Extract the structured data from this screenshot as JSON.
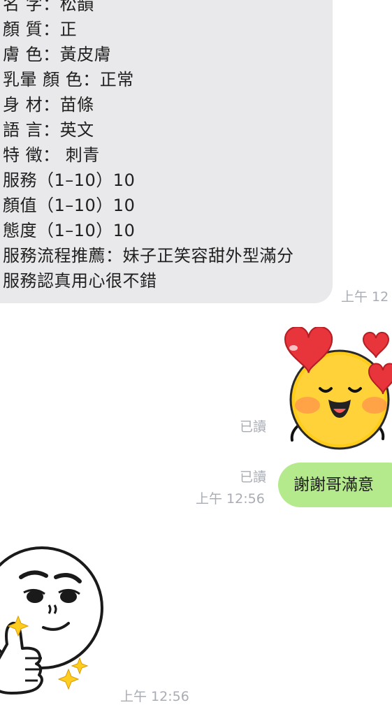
{
  "messages": {
    "incoming_text": {
      "lines": [
        "名 字：松韻",
        "顏 質：正",
        "膚 色：黃皮膚",
        "乳暈 顏 色：正常",
        "身 材：苗條",
        "語 言：英文",
        "特 徵： 刺青",
        "服務（1–10）10",
        "顏值（1–10）10",
        "態度（1–10）10",
        "服務流程推薦：妹子正笑容甜外型滿分",
        "服務認真用心很不錯"
      ],
      "time": "上午 12"
    },
    "outgoing_sticker": {
      "icon": "heart-eyes-face-sticker",
      "read_label": "已讀"
    },
    "outgoing_text": {
      "text": "謝謝哥滿意",
      "read_label": "已讀",
      "time": "上午 12:56"
    },
    "incoming_sticker": {
      "icon": "thumbs-up-smug-face-sticker",
      "time": "上午 12:56"
    }
  },
  "colors": {
    "incoming_bubble": "#e9e9eb",
    "outgoing_bubble": "#b5ea8c",
    "meta_text": "#a9adb3",
    "background": "#ffffff"
  }
}
